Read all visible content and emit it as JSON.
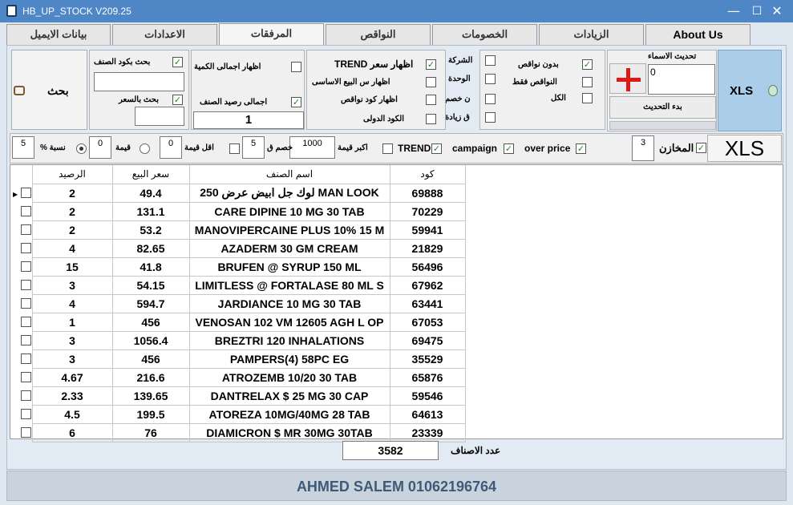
{
  "window": {
    "title": "HB_UP_STOCK V209.25",
    "minimize": "—",
    "maximize": "☐",
    "close": "✕"
  },
  "tabs": [
    {
      "label": "About Us"
    },
    {
      "label": "الزيادات"
    },
    {
      "label": "الخصومات"
    },
    {
      "label": "النواقص"
    },
    {
      "label": "المرفقات"
    },
    {
      "label": "الاعدادات"
    },
    {
      "label": "بيانات الايميل"
    }
  ],
  "toolbar": {
    "xls_big_label": "XLS",
    "names_update_label": "تحديث الاسماء",
    "names_update_value": "0",
    "start_update_label": "بدء التحديث",
    "filter_no_shortages": "بدون نواقص",
    "filter_shortages_only": "النواقص فقط",
    "filter_all": "الكل",
    "company_label": "الشركة",
    "unit_label": "الوحدة",
    "discount_label": "ن خصم",
    "increase_label": "ق زيادة",
    "show_trend_price": "TREND اظهار سعر",
    "show_base_sale_price": "اظهار س البيع الاساسى",
    "show_shortage_code": "اظهار كود نواقص",
    "intl_code": "الكود الدولى",
    "show_total_qty": "اظهار اجمالى الكمية",
    "total_item_balance": "اجمالى رصيد الصنف",
    "total_item_balance_value": "1",
    "search_by_code": "بحث بكود الصنف",
    "search_by_price": "بحث بالسعر",
    "search_button": "بحث"
  },
  "filters": {
    "xls_label": "XLS",
    "stores_label": "المخازن",
    "stores_value": "3",
    "over_price": "over price",
    "campaign": "campaign",
    "trend": "TREND",
    "greater_value_label": "اكبر قيمة",
    "greater_value": "1000",
    "discount_label": "خصم ق",
    "discount_value": "5",
    "less_value_label": "اقل قيمة",
    "less_value": "0",
    "value_label": "قيمة",
    "value_value": "0",
    "percent_label": "% نسبة",
    "percent_value": "5"
  },
  "table": {
    "headers": {
      "code": "كود",
      "name": "اسم الصنف",
      "price": "سعر البيع",
      "balance": "الرصيد"
    },
    "rows": [
      {
        "code": "69888",
        "name": "لوك جل ابيض عرض 250  MAN LOOK",
        "price": "49.4",
        "balance": "2"
      },
      {
        "code": "70229",
        "name": "CARE DIPINE 10 MG 30 TAB",
        "price": "131.1",
        "balance": "2"
      },
      {
        "code": "59941",
        "name": "MANOVIPERCAINE PLUS 10% 15 M",
        "price": "53.2",
        "balance": "2"
      },
      {
        "code": "21829",
        "name": "AZADERM 30 GM CREAM",
        "price": "82.65",
        "balance": "4"
      },
      {
        "code": "56496",
        "name": "BRUFEN @ SYRUP 150 ML",
        "price": "41.8",
        "balance": "15"
      },
      {
        "code": "67962",
        "name": "LIMITLESS @ FORTALASE 80 ML S",
        "price": "54.15",
        "balance": "3"
      },
      {
        "code": "63441",
        "name": "JARDIANCE 10 MG 30 TAB",
        "price": "594.7",
        "balance": "4"
      },
      {
        "code": "67053",
        "name": "VENOSAN 102 VM 12605 AGH L OP",
        "price": "456",
        "balance": "1"
      },
      {
        "code": "69475",
        "name": "BREZTRI 120 INHALATIONS",
        "price": "1056.4",
        "balance": "3"
      },
      {
        "code": "35529",
        "name": "PAMPERS(4) 58PC EG",
        "price": "456",
        "balance": "3"
      },
      {
        "code": "65876",
        "name": "ATROZEMB  10/20  30 TAB",
        "price": "216.6",
        "balance": "4.67"
      },
      {
        "code": "59546",
        "name": "DANTRELAX $ 25 MG 30 CAP",
        "price": "139.65",
        "balance": "2.33"
      },
      {
        "code": "64613",
        "name": "ATOREZA 10MG/40MG 28 TAB",
        "price": "199.5",
        "balance": "4.5"
      },
      {
        "code": "23339",
        "name": "DIAMICRON $ MR 30MG 30TAB",
        "price": "76",
        "balance": "6"
      }
    ]
  },
  "footer": {
    "item_count_label": "عدد الاصناف",
    "item_count": "3582",
    "credit": "AHMED SALEM 01062196764"
  }
}
